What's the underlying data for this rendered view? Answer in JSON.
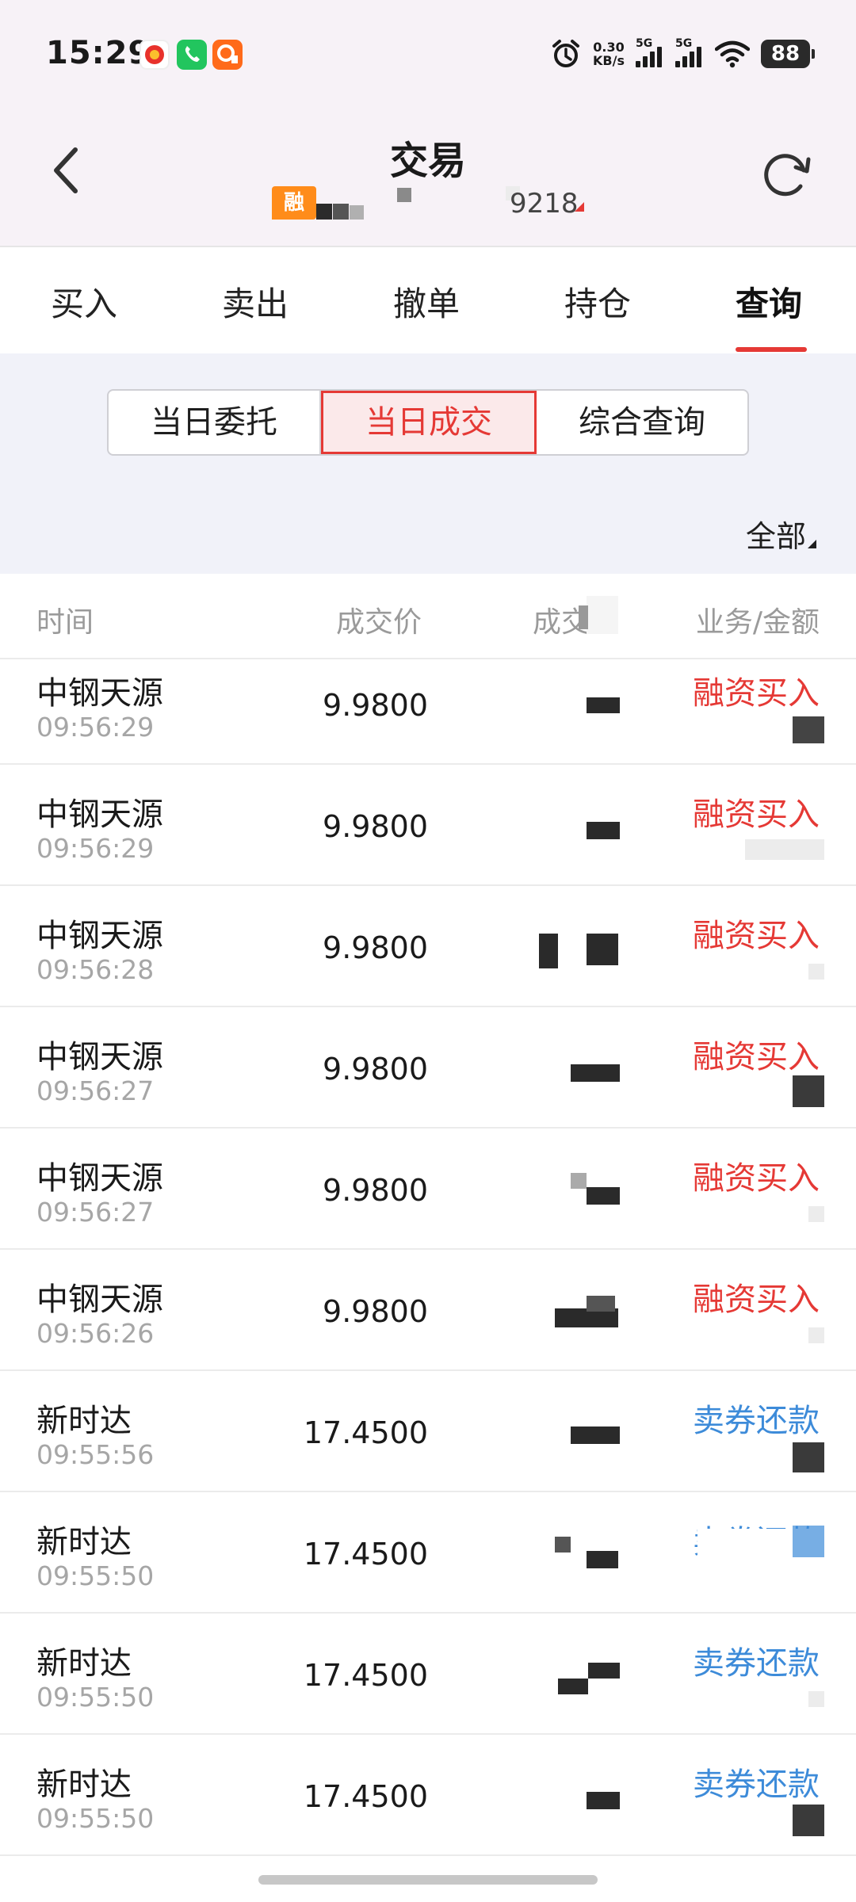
{
  "status_bar": {
    "time": "15:29",
    "net_speed_value": "0.30",
    "net_speed_unit": "KB/s",
    "signal_1_label": "5G",
    "signal_2_label": "5G",
    "battery": "88"
  },
  "header": {
    "title": "交易",
    "account_badge": "融",
    "account_number_fragment": "9218"
  },
  "tabs": [
    {
      "label": "买入"
    },
    {
      "label": "卖出"
    },
    {
      "label": "撤单"
    },
    {
      "label": "持仓"
    },
    {
      "label": "查询",
      "active": true
    }
  ],
  "segment": [
    {
      "label": "当日委托"
    },
    {
      "label": "当日成交",
      "active": true
    },
    {
      "label": "综合查询"
    }
  ],
  "filter": {
    "label": "全部"
  },
  "table": {
    "headers": [
      "时间",
      "成交价",
      "成交",
      "业务/金额"
    ],
    "rows": [
      {
        "name": "中钢天源",
        "time": "09:56:29",
        "price": "9.9800",
        "business": "融资买入"
      },
      {
        "name": "中钢天源",
        "time": "09:56:29",
        "price": "9.9800",
        "business": "融资买入"
      },
      {
        "name": "中钢天源",
        "time": "09:56:28",
        "price": "9.9800",
        "business": "融资买入"
      },
      {
        "name": "中钢天源",
        "time": "09:56:27",
        "price": "9.9800",
        "business": "融资买入"
      },
      {
        "name": "中钢天源",
        "time": "09:56:27",
        "price": "9.9800",
        "business": "融资买入"
      },
      {
        "name": "中钢天源",
        "time": "09:56:26",
        "price": "9.9800",
        "business": "融资买入"
      },
      {
        "name": "新时达",
        "time": "09:55:56",
        "price": "17.4500",
        "business": "卖券还款"
      },
      {
        "name": "新时达",
        "time": "09:55:50",
        "price": "17.4500",
        "business": "卖券还款"
      },
      {
        "name": "新时达",
        "time": "09:55:50",
        "price": "17.4500",
        "business": "卖券还款"
      },
      {
        "name": "新时达",
        "time": "09:55:50",
        "price": "17.4500",
        "business": "卖券还款"
      }
    ]
  },
  "colors": {
    "accent_red": "#e53935",
    "repay_blue": "#3d8bd9",
    "header_bg": "#f7f2f7",
    "filter_bg": "#f1f2f9"
  },
  "icons": {
    "back": "chevron-left-icon",
    "refresh": "refresh-icon",
    "alarm": "alarm-icon",
    "wifi": "wifi-icon"
  }
}
